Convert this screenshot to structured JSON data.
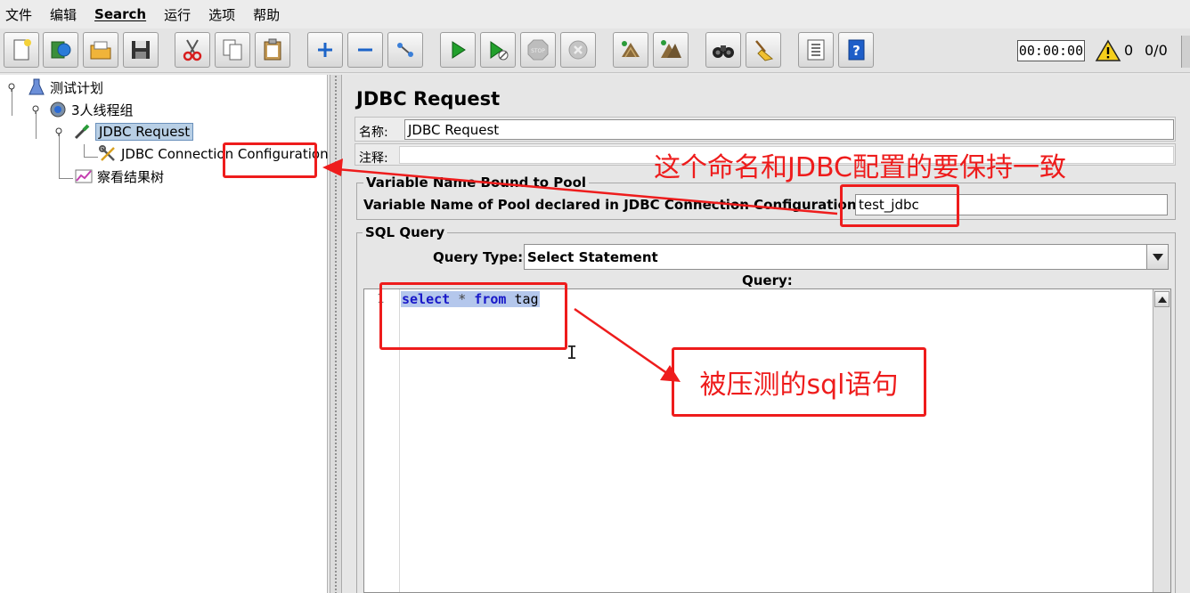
{
  "menu": [
    "文件",
    "编辑",
    "Search",
    "运行",
    "选项",
    "帮助"
  ],
  "toolbar": {
    "buttons": [
      "new-icon",
      "templates-icon",
      "open-icon",
      "save-icon",
      "cut-icon",
      "copy-icon",
      "paste-icon",
      "expand-icon",
      "collapse-icon",
      "toggle-icon",
      "start-icon",
      "start-no-pauses-icon",
      "stop-icon",
      "shutdown-icon",
      "clear-icon",
      "clear-all-icon",
      "search-icon",
      "reset-search-icon",
      "function-helper-icon",
      "help-icon"
    ],
    "timer": "00:00:00",
    "error_count": "0",
    "threads_ratio": "0/0"
  },
  "tree": {
    "nodes": [
      "测试计划",
      "3人线程组",
      "JDBC Request",
      "JDBC Connection Configuration",
      "察看结果树"
    ]
  },
  "panel": {
    "title": "JDBC Request",
    "name_label": "名称:",
    "name_value": "JDBC Request",
    "comment_label": "注释:",
    "pool_legend": "Variable Name Bound to Pool",
    "pool_label": "Variable Name of Pool declared in JDBC Connection Configuration:",
    "pool_value": "test_jdbc",
    "sql_legend": "SQL Query",
    "query_type_label": "Query Type:",
    "query_type_value": "Select Statement",
    "query_label": "Query:",
    "line_number": "1",
    "code": {
      "kw1": "select",
      "op": "*",
      "kw2": "from",
      "table": "tag"
    }
  },
  "annotations": {
    "note1": "这个命名和JDBC配置的要保持一致",
    "note2": "被压测的sql语句",
    "color": "#ee1c1c"
  }
}
